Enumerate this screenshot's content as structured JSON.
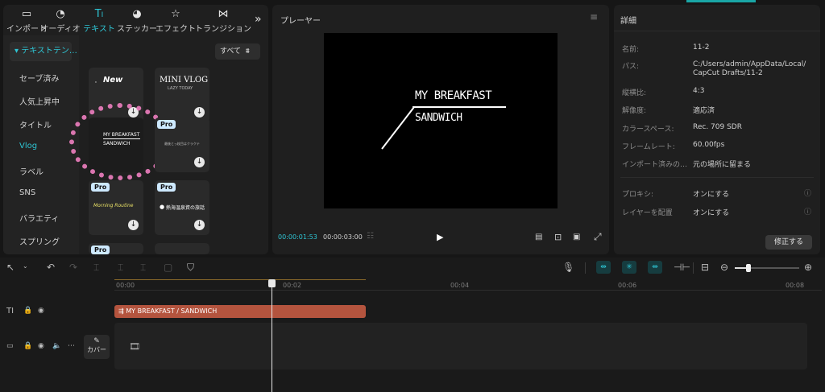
{
  "top_tabs": [
    {
      "label": "インポート",
      "icon": "import-icon"
    },
    {
      "label": "オーディオ",
      "icon": "audio-icon"
    },
    {
      "label": "テキスト",
      "icon": "text-icon"
    },
    {
      "label": "ステッカー",
      "icon": "sticker-icon"
    },
    {
      "label": "エフェクト",
      "icon": "effect-icon"
    },
    {
      "label": "トランジション",
      "icon": "transition-icon"
    }
  ],
  "sidebar": {
    "highlight": "▾ テキストテン…",
    "items": [
      "セーブ済み",
      "人気上昇中",
      "タイトル",
      "Vlog",
      "ラベル",
      "SNS",
      "バラエティ",
      "スプリング"
    ],
    "active_index": 3
  },
  "filter_button": "すべて",
  "tiles": {
    "tile1_text": "New",
    "tile2_title": "MINI VLOG",
    "tile2_sub": "LAZY TODAY",
    "tile3_line1": "MY BREAKFAST",
    "tile3_line2": "SANDWICH",
    "tile4_text": "最後とっ枚目はクラクテ",
    "tile5_text": "Morning Routine",
    "tile6_text": "熱海温泉資の旅話",
    "pro_badge": "Pro"
  },
  "player": {
    "title": "プレーヤー",
    "line1": "MY BREAKFAST",
    "line2": "SANDWICH",
    "current_time": "00:00:01:53",
    "total_time": "00:00:03:00"
  },
  "details": {
    "title": "詳細",
    "rows": [
      {
        "label": "名前:",
        "value": "11-2"
      },
      {
        "label": "パス:",
        "value": "C:/Users/admin/AppData/Local/"
      },
      {
        "label": "",
        "value": "CapCut Drafts/11-2"
      },
      {
        "label": "縦横比:",
        "value": "4:3"
      },
      {
        "label": "解像度:",
        "value": "適応済"
      },
      {
        "label": "カラースペース:",
        "value": "Rec. 709 SDR"
      },
      {
        "label": "フレームレート:",
        "value": "60.00fps"
      },
      {
        "label": "インポート済みの…",
        "value": "元の場所に留まる"
      }
    ],
    "proxy_label": "プロキシ:",
    "proxy_value": "オンにする",
    "layer_label": "レイヤーを配置",
    "layer_value": "オンにする",
    "edit_button": "修正する"
  },
  "timeline": {
    "ruler": [
      "00:00",
      "00:02",
      "00:04",
      "00:06",
      "00:08"
    ],
    "text_clip": "MY BREAKFAST / SANDWICH",
    "cover_label": "カバー"
  },
  "colors": {
    "accent": "#2ec5d4",
    "clip": "#b4543e"
  }
}
